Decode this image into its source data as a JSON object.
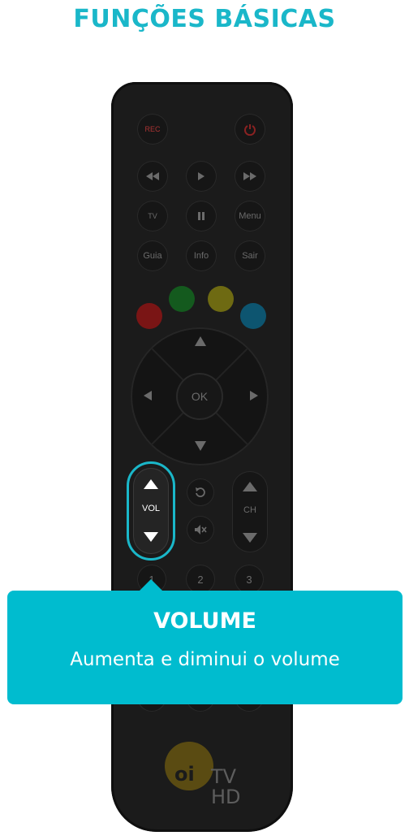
{
  "page": {
    "title": "FUNÇÕES BÁSICAS"
  },
  "remote": {
    "row1": {
      "rec": "REC",
      "power_icon": "power-icon"
    },
    "row2": {
      "rewind_icon": "rewind-icon",
      "play_icon": "play-icon",
      "forward_icon": "fast-forward-icon"
    },
    "row3": {
      "tv_label": "TV",
      "pause_icon": "pause-icon",
      "menu": "Menu"
    },
    "row4": {
      "guia": "Guia",
      "info": "Info",
      "sair": "Sair"
    },
    "colors": {
      "red": "#7a1515",
      "green": "#145a1e",
      "yellow": "#6e6a12",
      "blue": "#0d5570"
    },
    "dpad": {
      "ok": "OK"
    },
    "vol_label": "VOL",
    "ch_label": "CH",
    "numbers": [
      "1",
      "2",
      "3"
    ],
    "accent": "#1ab7c9",
    "logo": {
      "oi": "oi",
      "tv": "TV",
      "hd": "HD"
    }
  },
  "tooltip": {
    "title": "VOLUME",
    "description": "Aumenta e diminui o volume",
    "bg": "#00bccf"
  }
}
